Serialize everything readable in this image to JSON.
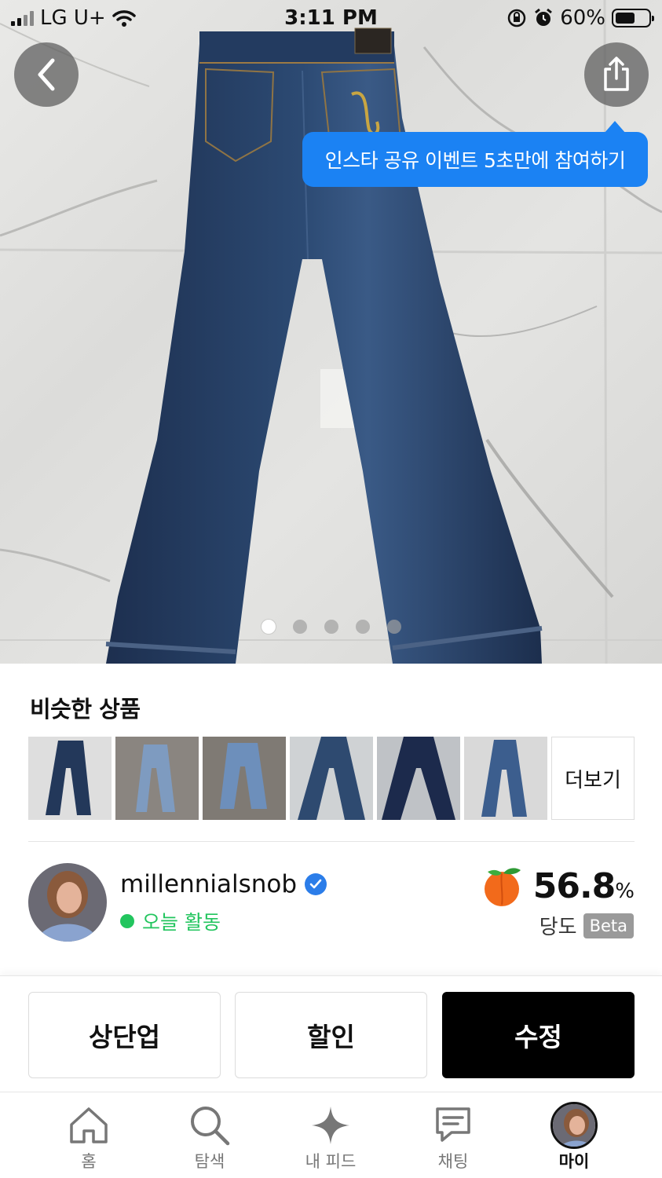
{
  "status_bar": {
    "carrier": "LG U+",
    "time": "3:11 PM",
    "battery_text": "60%",
    "battery_level": 0.6
  },
  "hero": {
    "tooltip": "인스타 공유 이벤트 5초만에 참여하기",
    "image_count": 5,
    "active_index": 0
  },
  "similar": {
    "title": "비슷한 상품",
    "more_label": "더보기"
  },
  "seller": {
    "username": "millennialsnob",
    "activity": "오늘 활동",
    "sweetness_value": "56.8",
    "sweetness_unit": "%",
    "sweetness_label": "당도",
    "beta_label": "Beta"
  },
  "actions": {
    "bump": "상단업",
    "discount": "할인",
    "edit": "수정"
  },
  "tabbar": {
    "home": "홈",
    "explore": "탐색",
    "feed": "내 피드",
    "chat": "채팅",
    "my": "마이"
  },
  "colors": {
    "tooltip_blue": "#1b82f3",
    "online_green": "#22c55e",
    "verified_blue": "#2b7de9"
  }
}
